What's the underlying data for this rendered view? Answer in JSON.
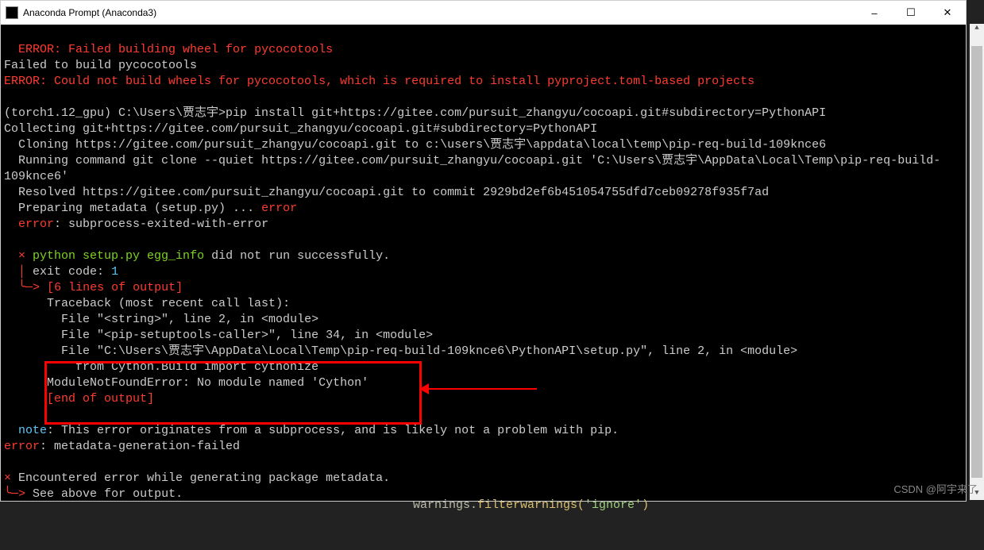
{
  "titlebar": {
    "title": "Anaconda Prompt (Anaconda3)",
    "min": "–",
    "max": "☐",
    "close": "✕"
  },
  "lines": {
    "l1": "  ERROR: Failed building wheel for pycocotools",
    "l2": "Failed to build pycocotools",
    "l3": "ERROR: Could not build wheels for pycocotools, which is required to install pyproject.toml-based projects",
    "l4": "",
    "l5a": "(torch1.12_gpu) ",
    "l5b": "C:\\Users\\贾志宇>",
    "l5c": "pip install git+https://gitee.com/pursuit_zhangyu/cocoapi.git#subdirectory=PythonAPI",
    "l6": "Collecting git+https://gitee.com/pursuit_zhangyu/cocoapi.git#subdirectory=PythonAPI",
    "l7": "  Cloning https://gitee.com/pursuit_zhangyu/cocoapi.git to c:\\users\\贾志宇\\appdata\\local\\temp\\pip-req-build-109knce6",
    "l8": "  Running command git clone --quiet https://gitee.com/pursuit_zhangyu/cocoapi.git 'C:\\Users\\贾志宇\\AppData\\Local\\Temp\\pip-req-build-109knce6'",
    "l9": "  Resolved https://gitee.com/pursuit_zhangyu/cocoapi.git to commit 2929bd2ef6b451054755dfd7ceb09278f935f7ad",
    "l10a": "  Preparing metadata (setup.py) ... ",
    "l10b": "error",
    "l11a": "  error",
    "l11b": ": subprocess-exited-with-error",
    "l12": "",
    "l13a": "  × ",
    "l13b": "python setup.py egg_info",
    "l13c": " did not run successfully.",
    "l14a": "  │ ",
    "l14b": "exit code: ",
    "l14c": "1",
    "l15a": "  ╰─> ",
    "l15b": "[6 lines of output]",
    "l16": "      Traceback (most recent call last):",
    "l17": "        File \"<string>\", line 2, in <module>",
    "l18": "        File \"<pip-setuptools-caller>\", line 34, in <module>",
    "l19": "        File \"C:\\Users\\贾志宇\\AppData\\Local\\Temp\\pip-req-build-109knce6\\PythonAPI\\setup.py\", line 2, in <module>",
    "l20": "          from Cython.Build import cythonize",
    "l21": "      ModuleNotFoundError: No module named 'Cython'",
    "l22": "      [end of output]",
    "l23": "",
    "l24a": "  note",
    "l24b": ": This error originates from a subprocess, and is likely not a problem with pip.",
    "l25a": "error",
    "l25b": ": metadata-generation-failed",
    "l26": "",
    "l27a": "× ",
    "l27b": "Encountered error while generating package metadata.",
    "l28a": "╰─> ",
    "l28b": "See above for output."
  },
  "watermark": "CSDN @阿宇来了",
  "bottom": {
    "a": "warnings.",
    "b": "filterwarnings(",
    "c": "'ignore'",
    "d": ")"
  }
}
